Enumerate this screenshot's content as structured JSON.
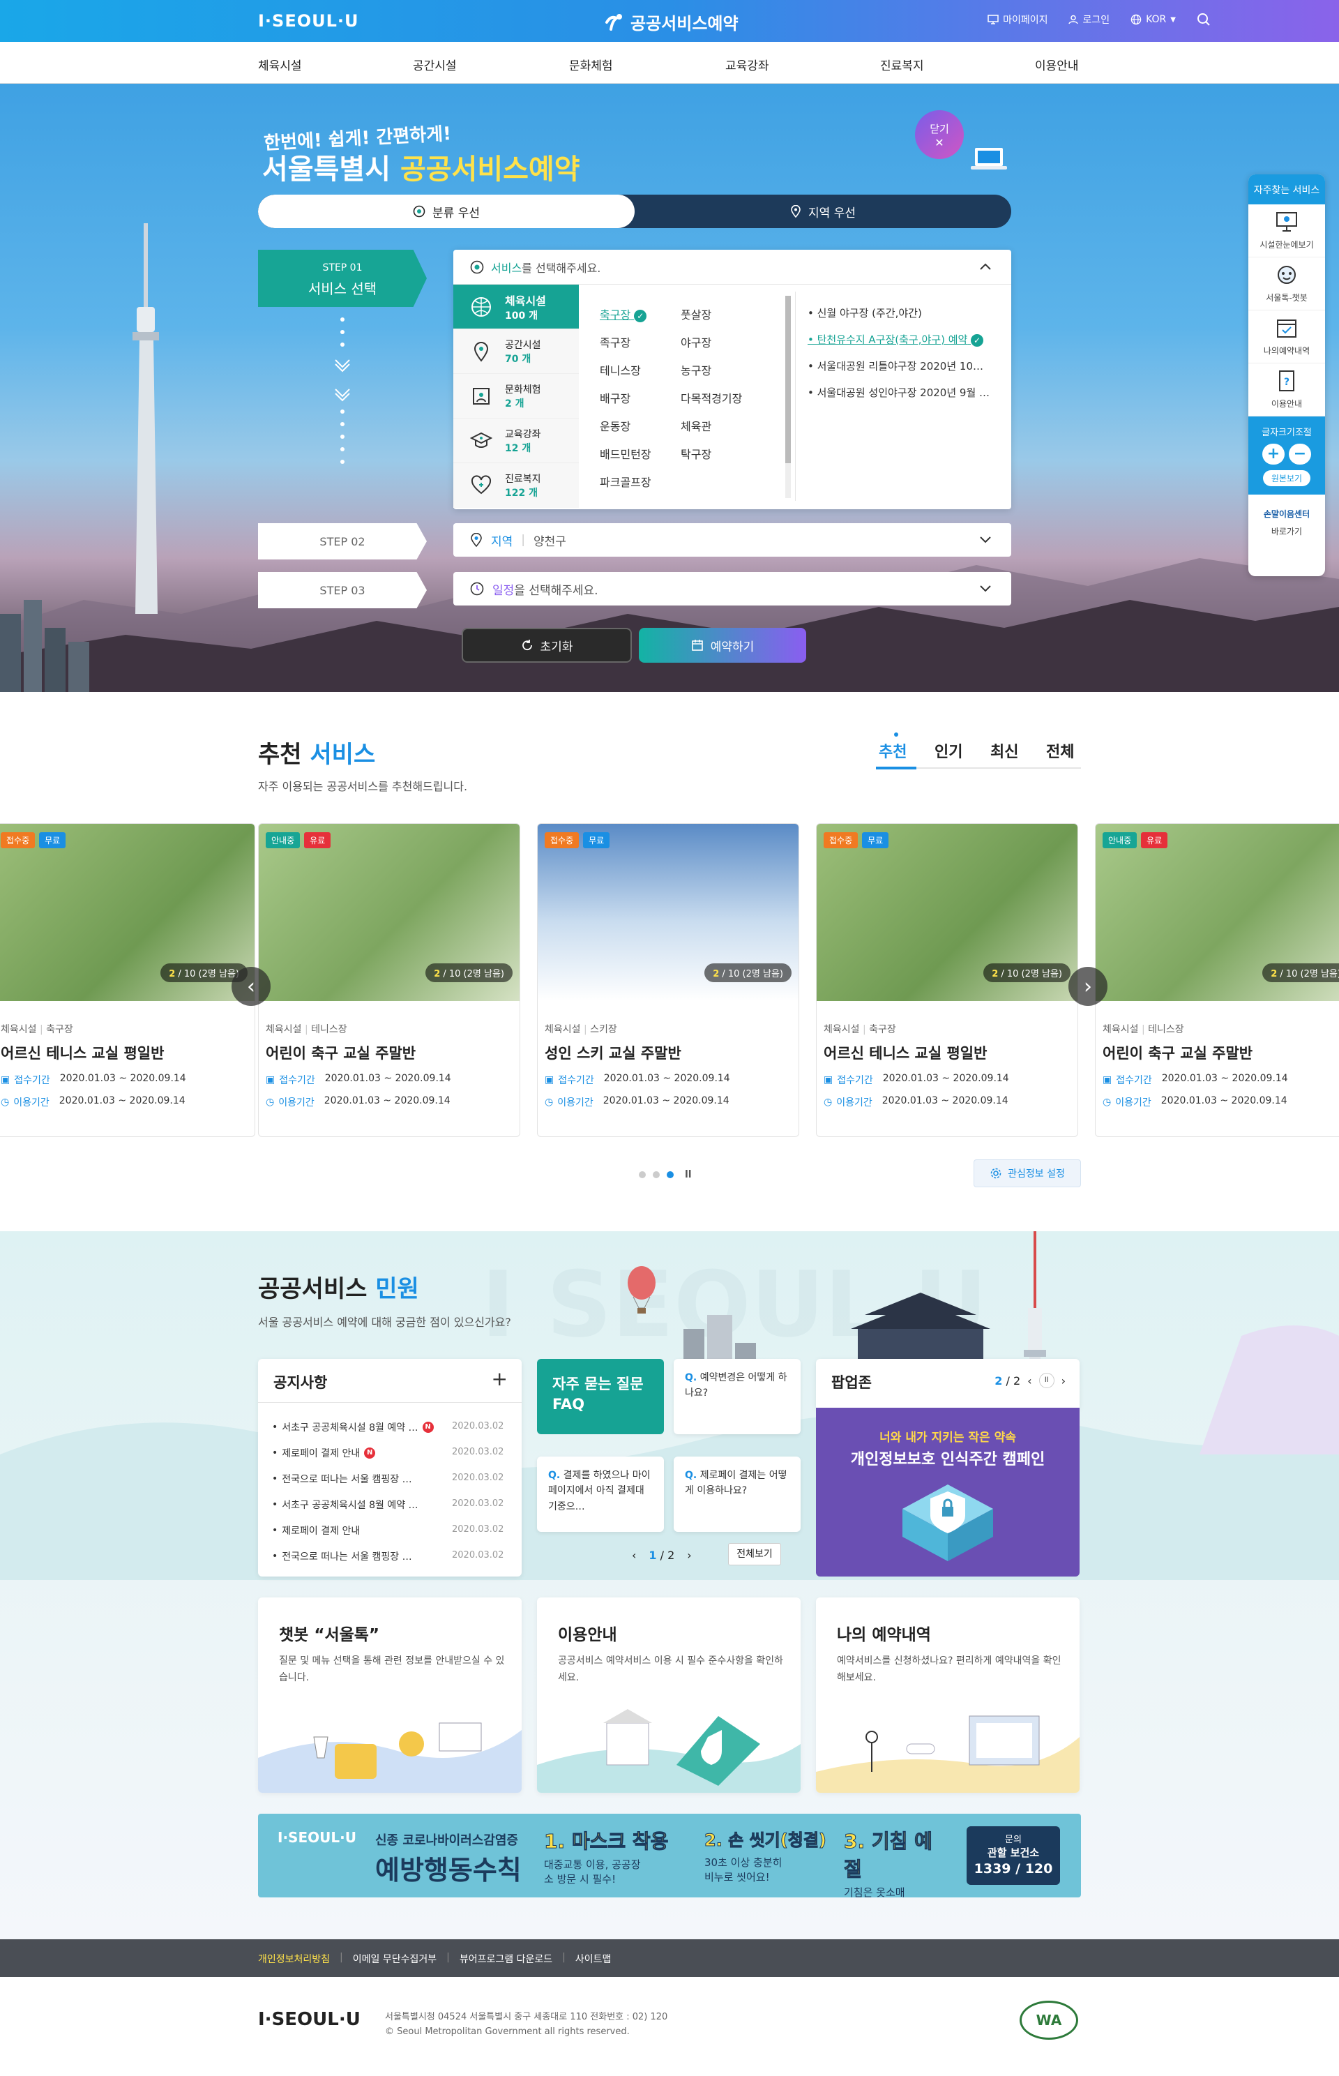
{
  "header": {
    "logo": "I·SEOUL·U",
    "site_title": "공공서비스예약",
    "mypage": "마이페이지",
    "login": "로그인",
    "lang": "KOR"
  },
  "nav": [
    "체육시설",
    "공간시설",
    "문화체험",
    "교육강좌",
    "진료복지",
    "이용안내"
  ],
  "hero": {
    "slogan_small": "한번에! 쉽게! 간편하게!",
    "slogan_main_a": "서울특별시 ",
    "slogan_main_b": "공공서비스예약",
    "close": "닫기",
    "toggle_category": "분류 우선",
    "toggle_region": "지역 우선",
    "step1_label": "STEP 01",
    "step1_name": "서비스 선택",
    "step2": "STEP 02",
    "step3": "STEP 03",
    "panel_prompt_a": "서비스",
    "panel_prompt_b": "를 선택해주세요.",
    "categories": [
      {
        "name": "체육시설",
        "count": "100 개"
      },
      {
        "name": "공간시설",
        "count": "70 개"
      },
      {
        "name": "문화체험",
        "count": "2 개"
      },
      {
        "name": "교육강좌",
        "count": "12 개"
      },
      {
        "name": "진료복지",
        "count": "122 개"
      }
    ],
    "subs_col1": [
      "축구장",
      "족구장",
      "테니스장",
      "배구장",
      "운동장",
      "배드민턴장",
      "파크골프장"
    ],
    "subs_col2": [
      "풋살장",
      "야구장",
      "농구장",
      "다목적경기장",
      "체육관",
      "탁구장"
    ],
    "results": [
      "신월 야구장 (주간,야간)",
      "탄천유수지 A구장(축구,야구) 예약",
      "서울대공원 리틀야구장 2020년 10…",
      "서울대공원 성인야구장 2020년 9월 …"
    ],
    "region_label": "지역",
    "region_value": "양천구",
    "date_prompt_a": "일정",
    "date_prompt_b": "을 선택해주세요.",
    "reset": "초기화",
    "book": "예약하기"
  },
  "quick_menu": {
    "title": "자주찾는 서비스",
    "items": [
      "시설한눈에보기",
      "서울톡-챗봇",
      "나의예약내역",
      "이용안내"
    ],
    "font_size": "글자크기조절",
    "plus": "+",
    "minus": "−",
    "original": "원본보기",
    "handsign": "손말이음센터",
    "goto": "바로가기"
  },
  "recommend": {
    "title_a": "추천 ",
    "title_b": "서비스",
    "subtitle": "자주 이용되는 공공서비스를 추천해드립니다.",
    "tabs": [
      "추천",
      "인기",
      "최신",
      "전체"
    ],
    "interest": "관심정보 설정",
    "cards": [
      {
        "b1": "접수중",
        "b2": "무료",
        "cat": "체육시설",
        "sub": "축구장",
        "title": "어르신 테니스 교실 평일반",
        "count_a": "2",
        "count_b": "/ 10 (2명 남음)",
        "recv": "접수기간",
        "use": "이용기간",
        "d1": "2020.01.03 ~ 2020.09.14",
        "d2": "2020.01.03 ~ 2020.09.14"
      },
      {
        "b1": "안내중",
        "b2": "유료",
        "cat": "체육시설",
        "sub": "테니스장",
        "title": "어린이 축구 교실 주말반",
        "count_a": "2",
        "count_b": "/ 10 (2명 남음)",
        "recv": "접수기간",
        "use": "이용기간",
        "d1": "2020.01.03 ~ 2020.09.14",
        "d2": "2020.01.03 ~ 2020.09.14"
      },
      {
        "b1": "접수중",
        "b2": "무료",
        "cat": "체육시설",
        "sub": "스키장",
        "title": "성인 스키 교실 주말반",
        "count_a": "2",
        "count_b": "/ 10 (2명 남음)",
        "recv": "접수기간",
        "use": "이용기간",
        "d1": "2020.01.03 ~ 2020.09.14",
        "d2": "2020.01.03 ~ 2020.09.14"
      },
      {
        "b1": "접수중",
        "b2": "무료",
        "cat": "체육시설",
        "sub": "축구장",
        "title": "어르신 테니스 교실 평일반",
        "count_a": "2",
        "count_b": "/ 10 (2명 남음)",
        "recv": "접수기간",
        "use": "이용기간",
        "d1": "2020.01.03 ~ 2020.09.14",
        "d2": "2020.01.03 ~ 2020.09.14"
      },
      {
        "b1": "안내중",
        "b2": "유료",
        "cat": "체육시설",
        "sub": "테니스장",
        "title": "어린이 축구 교실 주말반",
        "count_a": "2",
        "count_b": "/ 10 (2명 남음)",
        "recv": "접수기간",
        "use": "이용기간",
        "d1": "2020.01.03 ~ 2020.09.14",
        "d2": "2020.01.03 ~ 2020.09.14"
      }
    ]
  },
  "minwon": {
    "title_a": "공공서비스 ",
    "title_b": "민원",
    "subtitle": "서울 공공서비스 예약에 대해 궁금한 점이 있으신가요?",
    "notice_title": "공지사항",
    "notices": [
      {
        "text": "서초구 공공체육시설 8월 예약 …",
        "date": "2020.03.02",
        "new": true
      },
      {
        "text": "제로페이 결제 안내",
        "date": "2020.03.02",
        "new": true
      },
      {
        "text": "전국으로 떠나는 서울 캠핑장 …",
        "date": "2020.03.02",
        "new": false
      },
      {
        "text": "서초구 공공체육시설 8월 예약 …",
        "date": "2020.03.02",
        "new": false
      },
      {
        "text": "제로페이 결제 안내",
        "date": "2020.03.02",
        "new": false
      },
      {
        "text": "전국으로 떠나는 서울 캠핑장 …",
        "date": "2020.03.02",
        "new": false
      }
    ],
    "faq_title_a": "자주 묻는 질문",
    "faq_title_b": "FAQ",
    "faqs": [
      {
        "q": "Q.",
        "t": "예약변경은 어떻게 하나요?"
      },
      {
        "q": "Q.",
        "t": "결제를 하였으나 마이페이지에서 아직 결제대기중으…"
      },
      {
        "q": "Q.",
        "t": "제로페이 결제는 어떻게 이용하나요?"
      }
    ],
    "faq_page": "1",
    "faq_total": "/ 2",
    "faq_all": "전체보기",
    "popup_title": "팝업존",
    "popup_page": "2",
    "popup_total": "/ 2",
    "popup_line1": "너와 내가 지키는 작은 약속",
    "popup_line2": "개인정보보호 인식주간 캠페인",
    "info_cards": [
      {
        "title": "챗봇 “서울톡”",
        "text": "질문 및 메뉴 선택을 통해 관련 정보를 안내받으실 수 있습니다."
      },
      {
        "title": "이용안내",
        "text": "공공서비스 예약서비스 이용 시 필수 준수사항을 확인하세요."
      },
      {
        "title": "나의 예약내역",
        "text": "예약서비스를 신청하셨나요? 편리하게 예약내역을 확인해보세요."
      }
    ]
  },
  "corona": {
    "logo": "I·SEOUL·U",
    "line1": "신종 코로나바이러스감염증",
    "line2": "예방행동수칙",
    "r1_title": "1. 마스크 착용",
    "r1_text": "대중교통 이용, 공공장소 방문 시 필수!",
    "r2_title": "2. 손 씻기(청결)",
    "r2_text": "30초 이상 충분히 비누로 씻어요!",
    "r3_title": "3. 기침 예절",
    "r3_text": "기침은 옷소매로 가리고 하세요!",
    "contact_label": "문의",
    "contact_org": "관할 보건소",
    "contact_num": "1339 / 120"
  },
  "footer": {
    "links": [
      "개인정보처리방침",
      "이메일 무단수집거부",
      "뷰어프로그램 다운로드",
      "사이트맵"
    ],
    "logo": "I·SEOUL·U",
    "address": "서울특별시청 04524 서울특별시 중구 세종대로 110 전화번호 : 02) 120",
    "copyright": "© Seoul Metropolitan Government all rights reserved.",
    "wa": "WA"
  },
  "colors": {
    "primary": "#1a8fe3",
    "teal": "#16a394",
    "purple": "#8a5ef0",
    "orange": "#f07a22",
    "red": "#e6303a"
  }
}
